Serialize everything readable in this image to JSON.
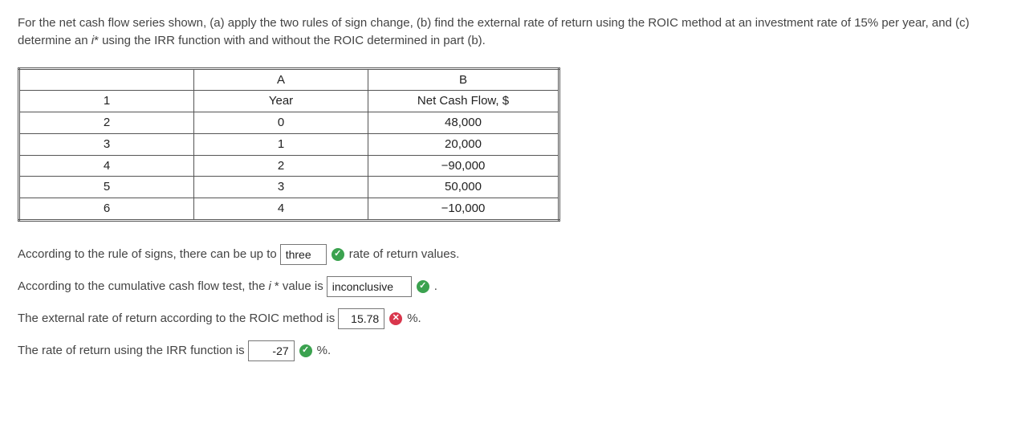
{
  "question": {
    "prefix": "For the net cash flow series shown, (a) apply the two rules of sign change, (b) find the external rate of return using the ROIC method at an investment rate of 15% per year, and (c) determine an ",
    "italic1": "i",
    "after_i1": "* using the IRR function with and without the ROIC determined in part (b)."
  },
  "table": {
    "header_blank": "",
    "header_A": "A",
    "header_B": "B",
    "rows": [
      {
        "n": "1",
        "a": "Year",
        "b": "Net Cash Flow, $"
      },
      {
        "n": "2",
        "a": "0",
        "b": "48,000"
      },
      {
        "n": "3",
        "a": "1",
        "b": "20,000"
      },
      {
        "n": "4",
        "a": "2",
        "b": "−90,000"
      },
      {
        "n": "5",
        "a": "3",
        "b": "50,000"
      },
      {
        "n": "6",
        "a": "4",
        "b": "−10,000"
      }
    ]
  },
  "answers": {
    "line1_pre": "According to the rule of signs, there can be up to",
    "line1_val": "three",
    "line1_post": "rate of return values.",
    "line2_pre": "According to the cumulative cash flow test, the ",
    "line2_i": "i",
    "line2_mid": "* value is",
    "line2_val": "inconclusive",
    "line2_post": ".",
    "line3_pre": "The external rate of return according to the ROIC method is",
    "line3_val": "15.78",
    "line3_post": "%.",
    "line4_pre": "The rate of return using the IRR function is",
    "line4_val": "-27",
    "line4_post": "%."
  },
  "icons": {
    "check": "✓",
    "cross": "✕"
  }
}
